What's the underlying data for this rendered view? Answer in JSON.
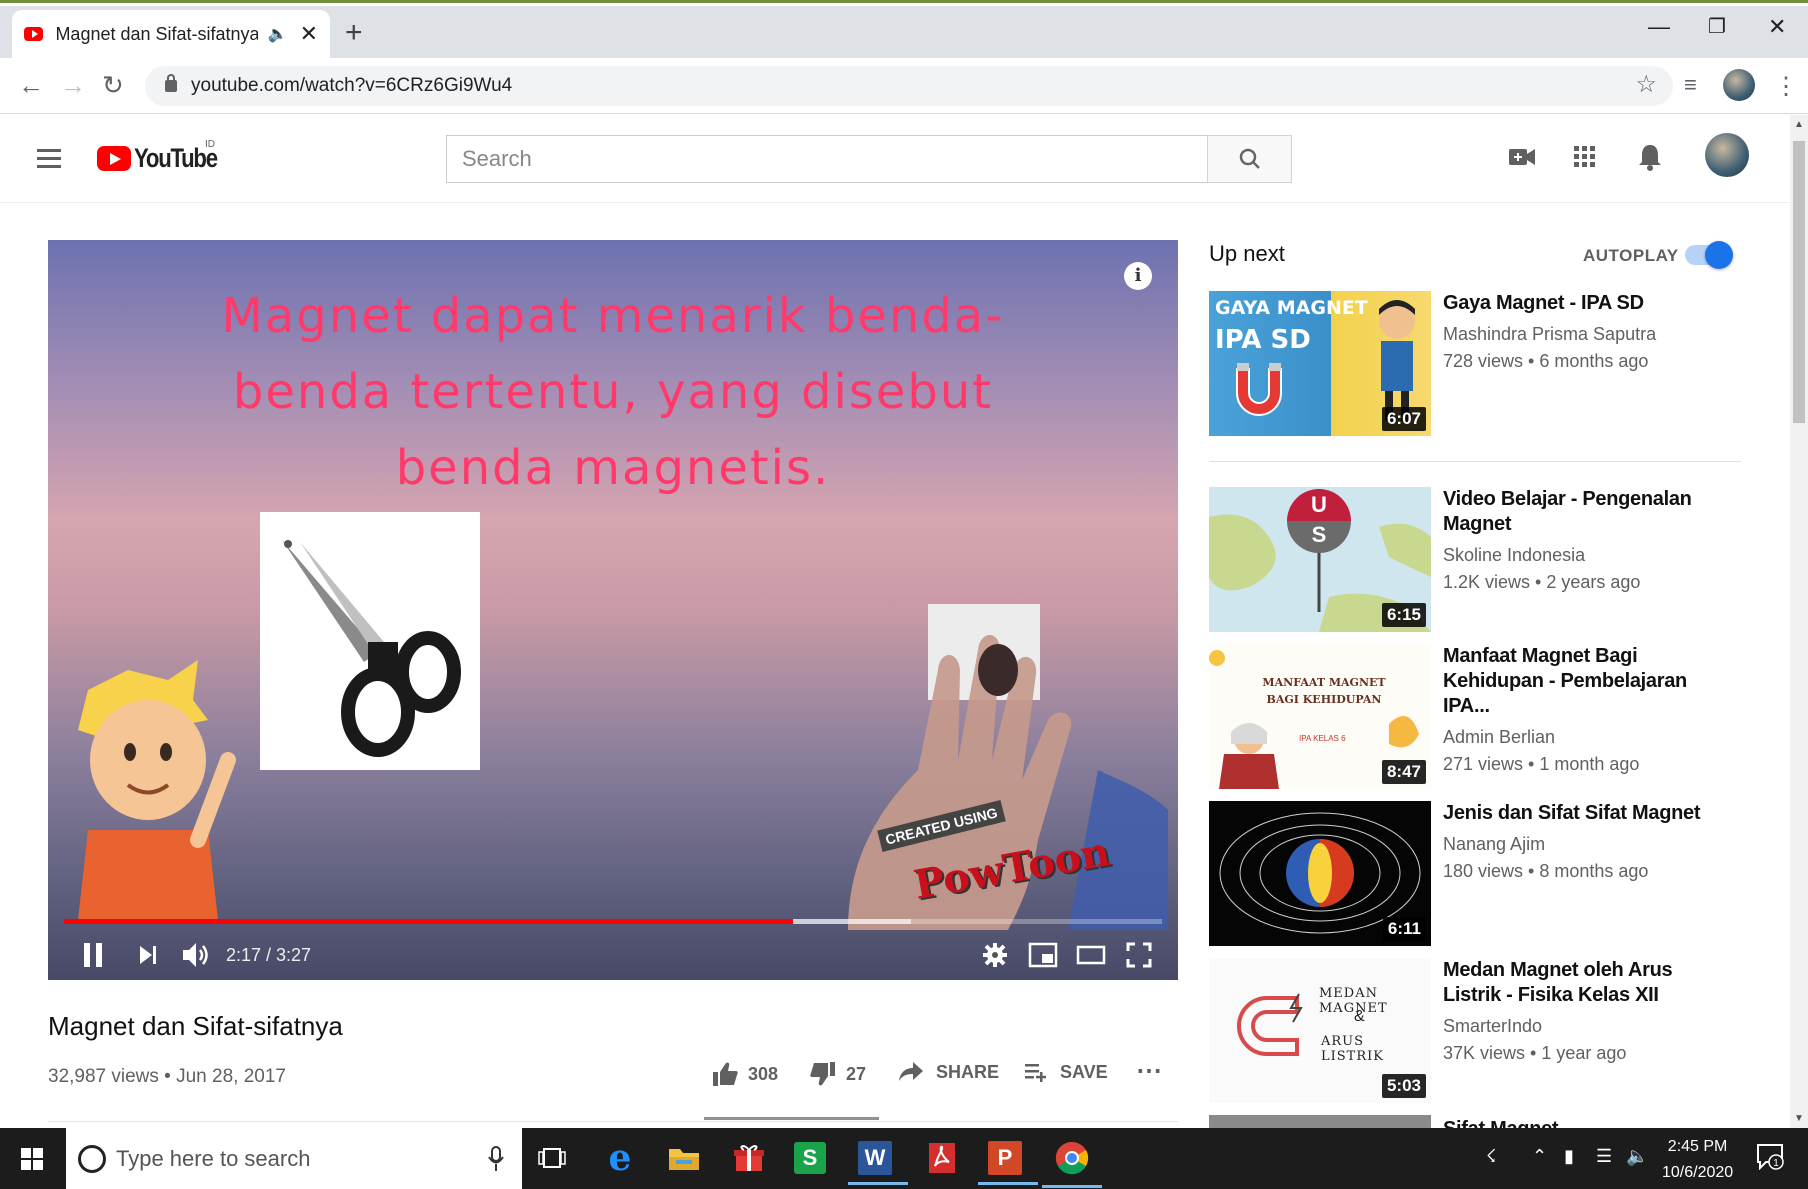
{
  "browser": {
    "tab_title": "Magnet dan Sifat-sifatnya - Y",
    "url": "youtube.com/watch?v=6CRz6Gi9Wu4",
    "new_tab_label": "+"
  },
  "youtube": {
    "logo_text": "YouTube",
    "country_code": "ID",
    "search_placeholder": "Search"
  },
  "video": {
    "overlay_lines": [
      "Magnet dapat menarik benda-",
      "benda tertentu, yang disebut",
      "benda magnetis."
    ],
    "time": "2:17 / 3:27",
    "progress_played": 0.664,
    "progress_buffered": 0.771,
    "watermark_top": "CREATED USING",
    "watermark_brand": "PowToon",
    "title": "Magnet dan Sifat-sifatnya",
    "views_date": "32,987 views • Jun 28, 2017",
    "likes": "308",
    "dislikes": "27",
    "share_label": "SHARE",
    "save_label": "SAVE",
    "like_ratio": 0.919
  },
  "sidebar": {
    "up_next": "Up next",
    "autoplay_label": "AUTOPLAY",
    "autoplay_on": true,
    "items": [
      {
        "title": "Gaya Magnet - IPA SD",
        "channel": "Mashindra Prisma Saputra",
        "meta": "728 views • 6 months ago",
        "duration": "6:07",
        "thumb_text1": "GAYA MAGNET",
        "thumb_text2": "IPA SD"
      },
      {
        "title": "Video Belajar - Pengenalan Magnet",
        "channel": "Skoline Indonesia",
        "meta": "1.2K views • 2 years ago",
        "duration": "6:15",
        "thumb_text1": "U",
        "thumb_text2": "S"
      },
      {
        "title": "Manfaat Magnet Bagi Kehidupan - Pembelajaran IPA...",
        "channel": "Admin Berlian",
        "meta": "271 views • 1 month ago",
        "duration": "8:47",
        "thumb_text1": "MANFAAT MAGNET BAGI KEHIDUPAN",
        "thumb_text2": "IPA KELAS 6"
      },
      {
        "title": "Jenis dan Sifat Sifat Magnet",
        "channel": "Nanang Ajim",
        "meta": "180 views • 8 months ago",
        "duration": "6:11"
      },
      {
        "title": "Medan Magnet oleh Arus Listrik - Fisika Kelas XII",
        "channel": "SmarterIndo",
        "meta": "37K views • 1 year ago",
        "duration": "5:03",
        "thumb_text1": "MEDAN MAGNET",
        "thumb_text2": "&",
        "thumb_text3": "ARUS LISTRIK"
      },
      {
        "title": "Sifat Magnet"
      }
    ]
  },
  "taskbar": {
    "search_placeholder": "Type here to search",
    "time": "2:45 PM",
    "date": "10/6/2020",
    "notification_count": "1"
  }
}
